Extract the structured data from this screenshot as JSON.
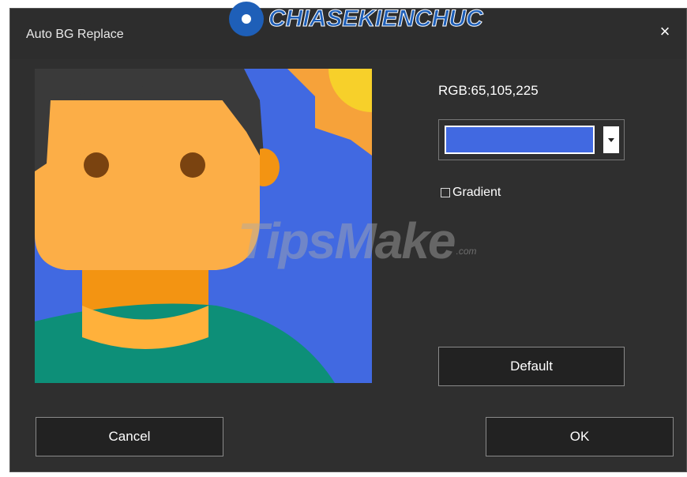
{
  "window": {
    "title": "Auto BG Replace",
    "close_glyph": "×"
  },
  "watermark": {
    "top_text": "CHIASEKIENCHUC",
    "main_text": "TipsMake",
    "suffix_text": ".com"
  },
  "color": {
    "rgb_label": "RGB:65,105,225",
    "swatch_color": "#4169e1"
  },
  "gradient": {
    "label": "Gradient",
    "checked": false
  },
  "buttons": {
    "default_label": "Default",
    "cancel_label": "Cancel",
    "ok_label": "OK"
  },
  "icons": {
    "close": "close-icon",
    "dropdown": "chevron-down-icon"
  }
}
